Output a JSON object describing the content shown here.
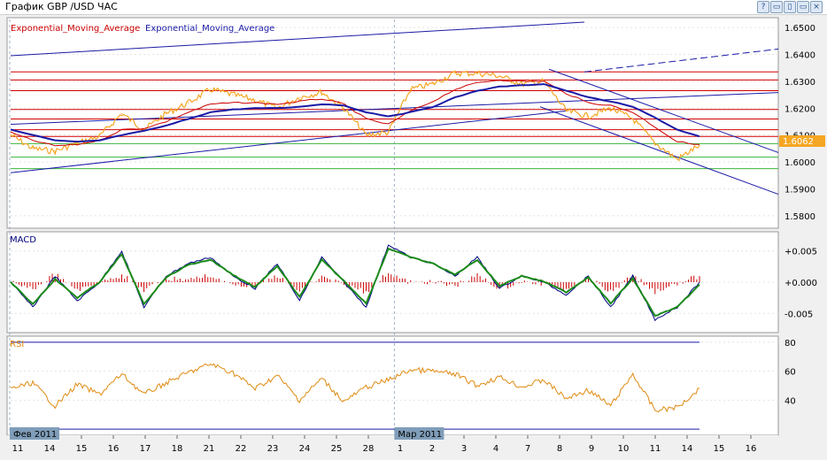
{
  "window": {
    "title": "График GBP /USD  ЧАС",
    "buttons": [
      "?",
      "▭",
      "▯",
      "▭",
      "×"
    ]
  },
  "legend": {
    "ema_red": "Exponential_Moving_Average",
    "ema_blue": "Exponential_Moving_Average"
  },
  "price_panel": {
    "current_price": "1.6062",
    "levels_red": [
      1.6335,
      1.6305,
      1.6265,
      1.6195,
      1.616,
      1.612,
      1.6095
    ],
    "levels_green": [
      1.6068,
      1.6018,
      1.5975
    ]
  },
  "macd_label": "MACD",
  "rsi_label": "RSI",
  "month_labels": [
    {
      "label": "Фев 2011",
      "index": 0
    },
    {
      "label": "Мар 2011",
      "index": 12
    }
  ],
  "colors": {
    "price": "#f5a623",
    "ema_red": "#cc0000",
    "ema_blue": "#1a1aa6",
    "levels_red": "#d00000",
    "levels_green": "#3cb43c",
    "macd_line": "#000080",
    "macd_signal": "#1a8a1a",
    "macd_hist": "#cc0000",
    "rsi": "#e08a10",
    "rsi_bounds": "#1a1aa6"
  },
  "chart_data": [
    {
      "type": "line",
      "panel": "price",
      "y_ticks": [
        "1.6500",
        "1.6400",
        "1.6300",
        "1.6200",
        "1.6100",
        "1.6000",
        "1.5900",
        "1.5800"
      ],
      "ylim": [
        1.576,
        1.653
      ],
      "x_ticks": [
        "11",
        "14",
        "15",
        "16",
        "17",
        "18",
        "21",
        "22",
        "23",
        "24",
        "25",
        "28",
        "1",
        "2",
        "3",
        "4",
        "7",
        "8",
        "9",
        "10",
        "11",
        "14",
        "15",
        "16"
      ],
      "x_ticks_future_from": 22,
      "series": [
        {
          "values": [
            1.61,
            1.605,
            1.604,
            1.607,
            1.6095,
            1.618,
            1.612,
            1.618,
            1.622,
            1.627,
            1.625,
            1.623,
            1.62,
            1.624,
            1.626,
            1.62,
            1.61,
            1.611,
            1.627,
            1.629,
            1.633,
            1.633,
            1.632,
            1.629,
            1.63,
            1.619,
            1.617,
            1.62,
            1.616,
            1.607,
            1.601,
            1.6062
          ]
        },
        {
          "values": [
            1.611,
            1.608,
            1.606,
            1.6065,
            1.608,
            1.612,
            1.6125,
            1.615,
            1.6185,
            1.6215,
            1.622,
            1.622,
            1.6215,
            1.6225,
            1.6235,
            1.6215,
            1.616,
            1.614,
            1.619,
            1.6225,
            1.627,
            1.6295,
            1.6305,
            1.63,
            1.63,
            1.6255,
            1.622,
            1.621,
            1.6185,
            1.613,
            1.6075,
            1.6065
          ]
        },
        {
          "values": [
            1.612,
            1.61,
            1.608,
            1.6075,
            1.608,
            1.61,
            1.6115,
            1.6135,
            1.616,
            1.6185,
            1.6195,
            1.62,
            1.62,
            1.6205,
            1.6215,
            1.621,
            1.6185,
            1.617,
            1.6185,
            1.6205,
            1.624,
            1.6265,
            1.628,
            1.6285,
            1.629,
            1.6265,
            1.624,
            1.6225,
            1.6205,
            1.6165,
            1.612,
            1.6095
          ]
        }
      ]
    },
    {
      "type": "line",
      "panel": "macd",
      "y_ticks": [
        "+0.005",
        "+0.000",
        "-0.005"
      ],
      "ylim": [
        -0.0078,
        0.0078
      ],
      "series": [
        {
          "values": [
            0.0,
            -0.004,
            0.001,
            -0.003,
            0.0,
            0.005,
            -0.004,
            0.001,
            0.003,
            0.004,
            0.001,
            -0.001,
            0.003,
            -0.003,
            0.004,
            0.0,
            -0.004,
            0.006,
            0.004,
            0.003,
            0.001,
            0.004,
            -0.001,
            0.001,
            0.0,
            -0.002,
            0.001,
            -0.004,
            0.001,
            -0.006,
            -0.004,
            0.0
          ]
        },
        {
          "values": [
            0.0,
            -0.0035,
            0.0005,
            -0.0025,
            0.0,
            0.0045,
            -0.0035,
            0.0008,
            0.0028,
            0.0036,
            0.0012,
            -0.0008,
            0.0026,
            -0.0024,
            0.0036,
            0.0002,
            -0.0034,
            0.0054,
            0.004,
            0.003,
            0.0012,
            0.0036,
            -0.0006,
            0.001,
            0.0001,
            -0.0016,
            0.0008,
            -0.0034,
            0.0006,
            -0.0054,
            -0.004,
            -0.0004
          ]
        }
      ]
    },
    {
      "type": "line",
      "panel": "rsi",
      "y_ticks": [
        "80",
        "60",
        "40"
      ],
      "ylim": [
        17,
        83
      ],
      "values": [
        48,
        52,
        36,
        51,
        44,
        58,
        44,
        52,
        59,
        65,
        59,
        48,
        57,
        40,
        55,
        39,
        49,
        54,
        61,
        60,
        58,
        50,
        56,
        49,
        54,
        41,
        47,
        36,
        58,
        33,
        35,
        48
      ]
    }
  ]
}
